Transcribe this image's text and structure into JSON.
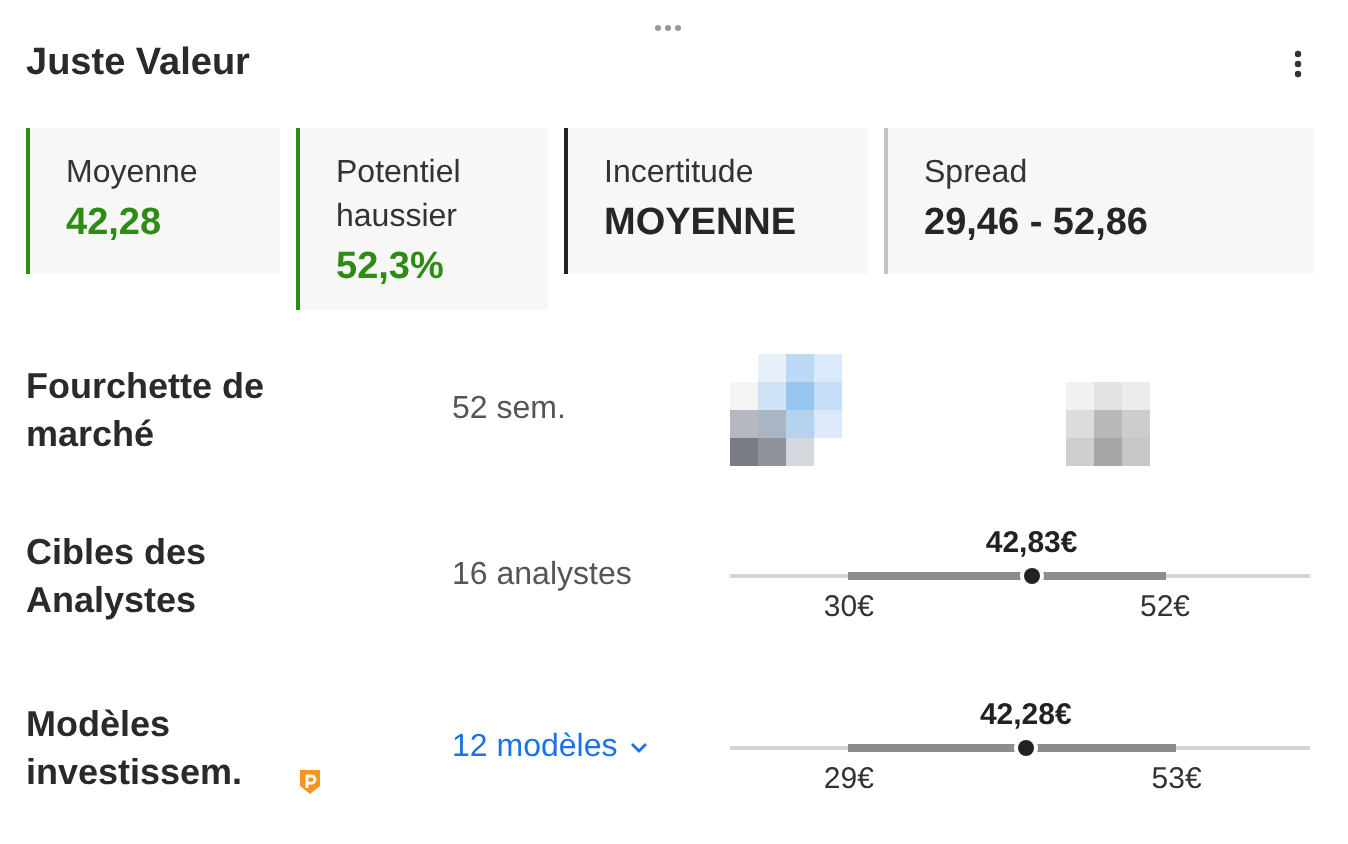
{
  "header": {
    "title": "Juste Valeur"
  },
  "cards": [
    {
      "label": "Moyenne",
      "value": "42,28",
      "kind": "positive",
      "color": "#2e8b13"
    },
    {
      "label": "Potentiel haussier",
      "value": "52,3%",
      "kind": "positive",
      "color": "#2e8b13"
    },
    {
      "label": "Incertitude",
      "value": "MOYENNE",
      "kind": "neutral",
      "color": "#222222"
    },
    {
      "label": "Spread",
      "value": "29,46 - 52,86",
      "kind": "neutral",
      "color": "#c4c4c4"
    }
  ],
  "rows": [
    {
      "kind": "picture",
      "label": "Fourchette de marché",
      "detail": "52 sem."
    },
    {
      "kind": "range",
      "label": "Cibles des Analystes",
      "detail": "16 analystes",
      "value": "42,83€",
      "low": "30€",
      "high": "52€",
      "level": 0.52
    },
    {
      "kind": "range",
      "label": "Modèles investissem.",
      "premium": true,
      "detail": "12 modèles",
      "detail_link": true,
      "value": "42,28€",
      "low": "29€",
      "high": "53€",
      "level": 0.51
    }
  ]
}
